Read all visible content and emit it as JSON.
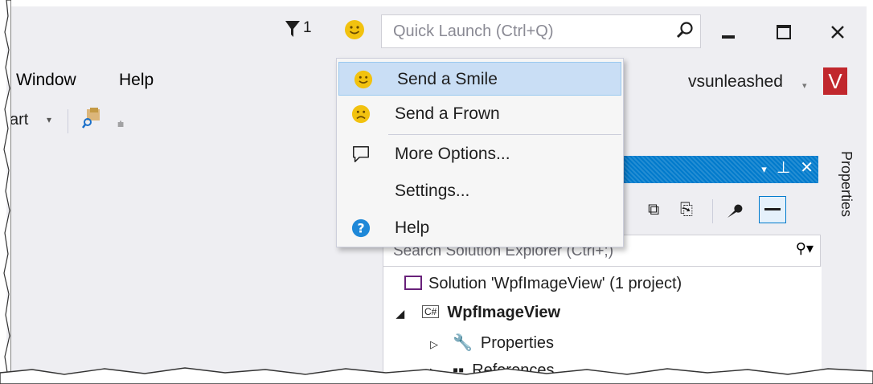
{
  "titlebar": {
    "notification_count": "1",
    "quick_launch_placeholder": "Quick Launch (Ctrl+Q)"
  },
  "menubar": {
    "items": [
      "Window",
      "Help"
    ]
  },
  "toolbar": {
    "partial_label": "art"
  },
  "account": {
    "name": "vsunleashed",
    "avatar_letter": "V",
    "avatar_color": "#c1272d"
  },
  "feedback_menu": {
    "items": [
      {
        "label": "Send a Smile",
        "icon": "smile-icon"
      },
      {
        "label": "Send a Frown",
        "icon": "frown-icon"
      },
      {
        "label": "More Options...",
        "icon": "speech-bubble-icon"
      },
      {
        "label": "Settings...",
        "icon": ""
      },
      {
        "label": "Help",
        "icon": "help-circle-icon"
      }
    ]
  },
  "solution_explorer": {
    "search_placeholder": "Search Solution Explorer (Ctrl+;)",
    "tree": [
      {
        "label": "Solution 'WpfImageView' (1 project)"
      },
      {
        "label": "WpfImageView",
        "badge": "C#"
      },
      {
        "label": "Properties"
      },
      {
        "label": "References"
      }
    ]
  },
  "side_tab": {
    "label": "Properties"
  },
  "colors": {
    "accent": "#007acc",
    "highlight": "#c9def5",
    "smile_yellow": "#f2c20f",
    "help_blue": "#1e88d8"
  }
}
